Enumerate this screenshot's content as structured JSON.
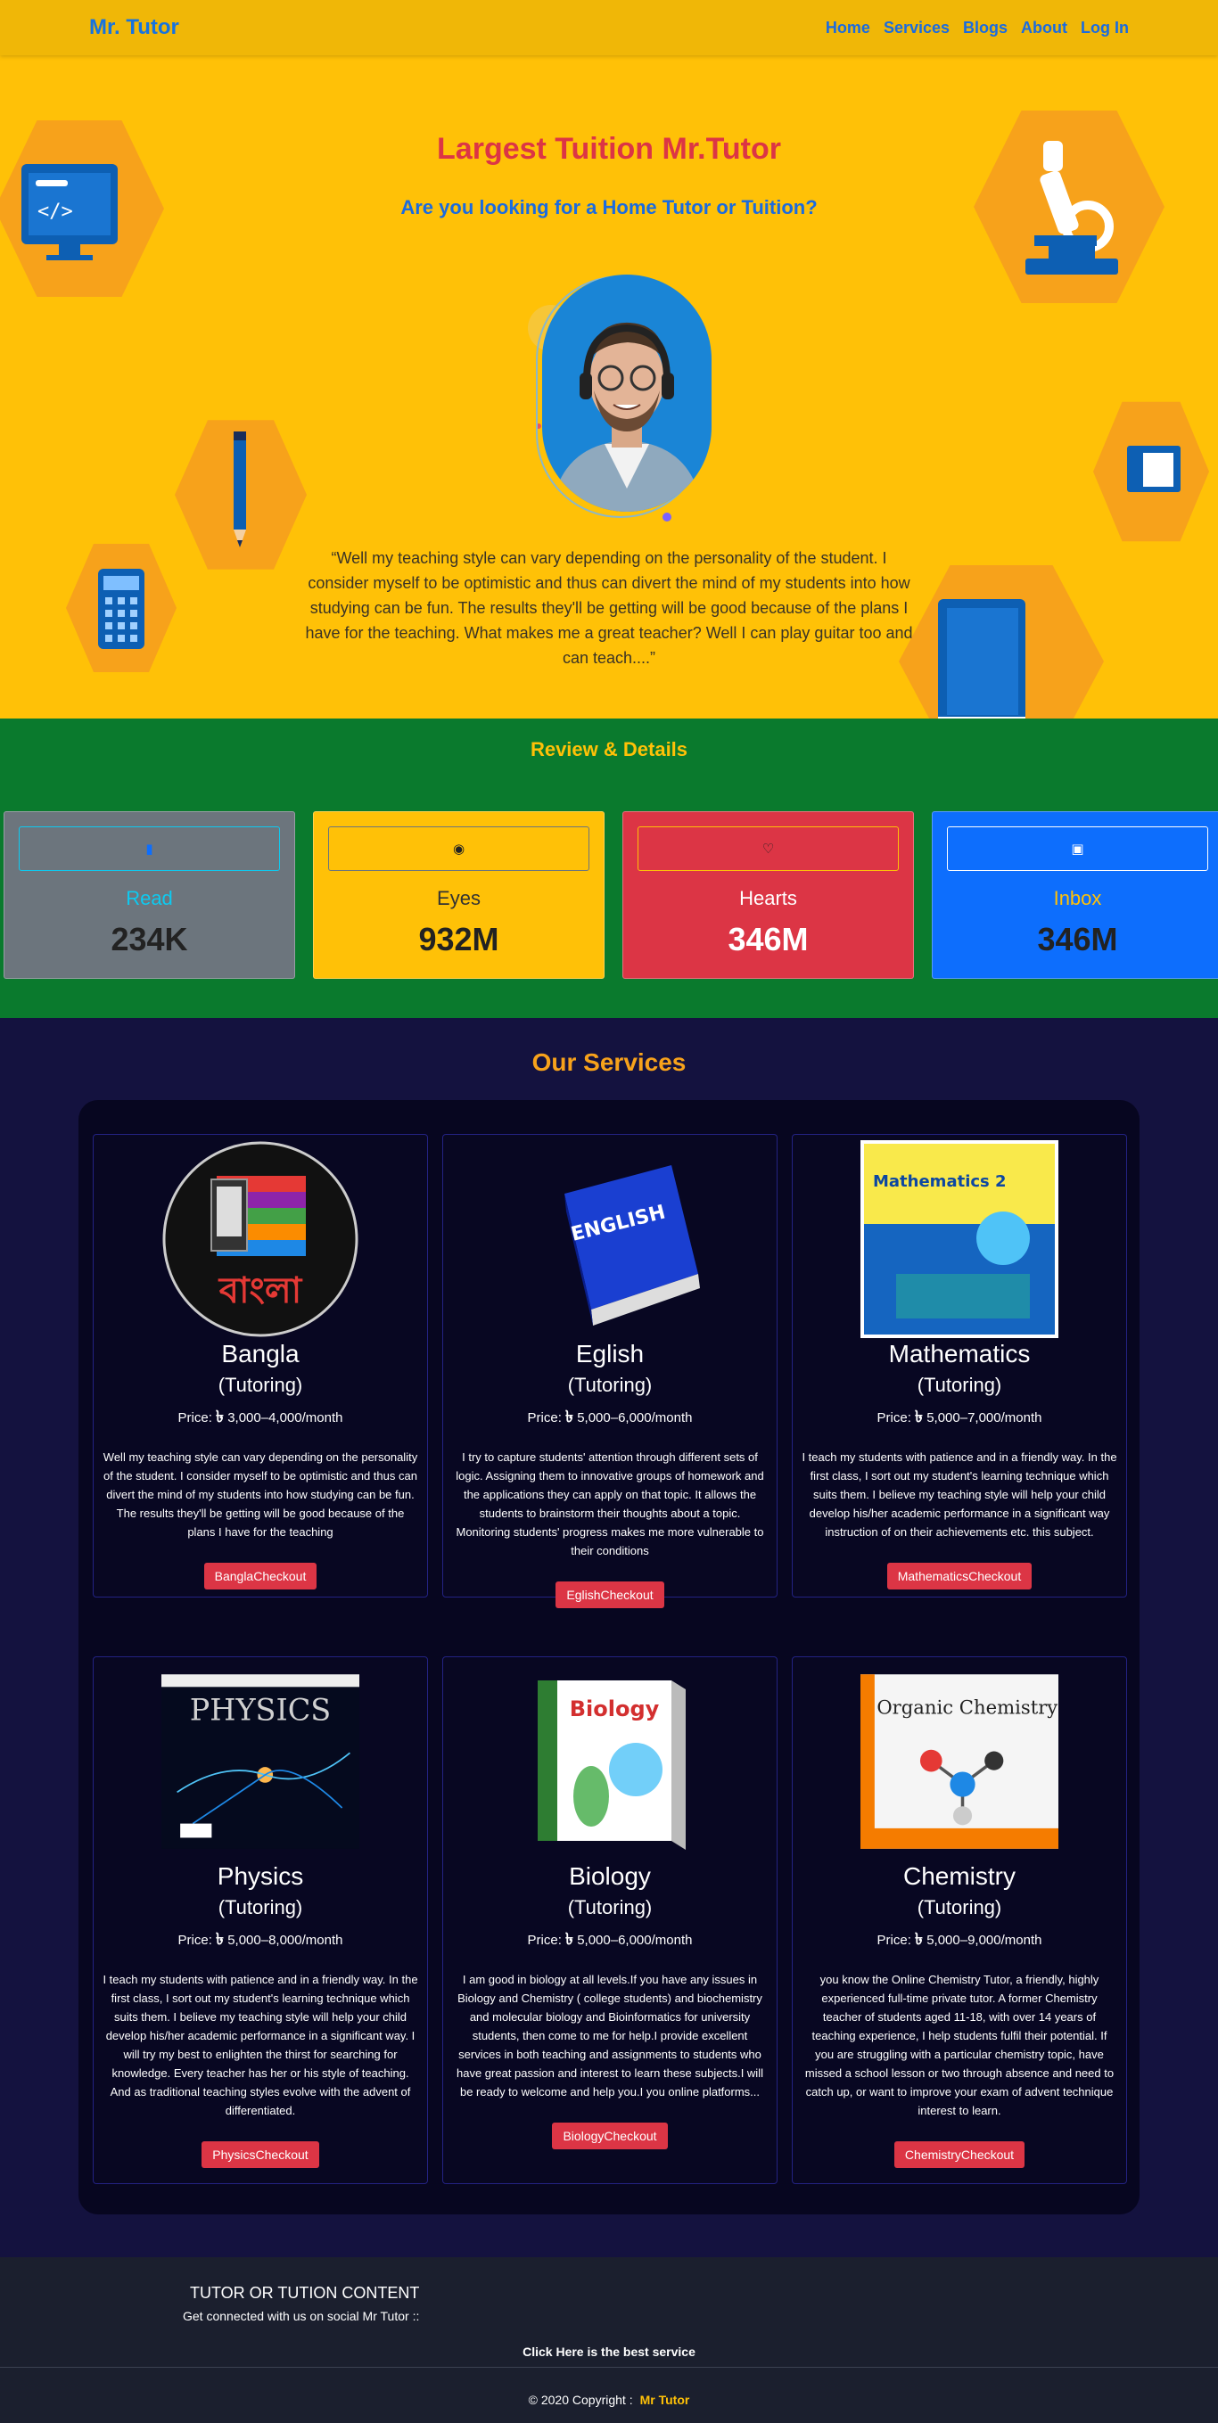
{
  "navbar": {
    "brand": "Mr. Tutor",
    "links": [
      "Home",
      "Services",
      "Blogs",
      "About",
      "Log In"
    ]
  },
  "hero": {
    "title": "Largest Tuition Mr.Tutor",
    "subtitle": "Are you looking for a Home Tutor or Tuition?",
    "quote": "“Well my teaching style can vary depending on the personality of the student. I consider myself to be optimistic and thus can divert the mind of my students into how studying can be fun. The results they'll be getting will be good because of the plans I have for the teaching. What makes me a great teacher? Well I can play guitar too and can teach....”"
  },
  "review": {
    "title": "Review & Details",
    "cards": [
      {
        "icon": "tablet-icon",
        "label": "Read",
        "value": "234K"
      },
      {
        "icon": "eye-icon",
        "label": "Eyes",
        "value": "932M"
      },
      {
        "icon": "heart-icon",
        "label": "Hearts",
        "value": "346M"
      },
      {
        "icon": "inbox-icon",
        "label": "Inbox",
        "value": "346M"
      }
    ]
  },
  "services": {
    "title": "Our Services",
    "items": [
      {
        "name": "Bangla",
        "kind": "(Tutoring)",
        "price_prefix": "Price:",
        "currency": "৳",
        "price": "3,000–4,000/month",
        "desc": "Well my teaching style can vary depending on the personality of the student. I consider myself to be optimistic and thus can divert the mind of my students into how studying can be fun. The results they'll be getting will be good because of the plans I have for the teaching",
        "button": "BanglaCheckout",
        "thumb_text": "বাংলা"
      },
      {
        "name": "Eglish",
        "kind": "(Tutoring)",
        "price_prefix": "Price:",
        "currency": "৳",
        "price": "5,000–6,000/month",
        "desc": "I try to capture students' attention through different sets of logic. Assigning them to innovative groups of homework and the applications they can apply on that topic. It allows the students to brainstorm their thoughts about a topic. Monitoring students' progress makes me more vulnerable to their conditions",
        "button": "EglishCheckout",
        "thumb_text": "ENGLISH"
      },
      {
        "name": "Mathematics",
        "kind": "(Tutoring)",
        "price_prefix": "Price:",
        "currency": "৳",
        "price": "5,000–7,000/month",
        "desc": "I teach my students with patience and in a friendly way. In the first class, I sort out my student's learning technique which suits them. I believe my teaching style will help your child develop his/her academic performance in a significant way instruction of on their achievements etc. this subject.",
        "button": "MathematicsCheckout",
        "thumb_text": "Mathematics 2"
      },
      {
        "name": "Physics",
        "kind": "(Tutoring)",
        "price_prefix": "Price:",
        "currency": "৳",
        "price": "5,000–8,000/month",
        "desc": "I teach my students with patience and in a friendly way. In the first class, I sort out my student's learning technique which suits them. I believe my teaching style will help your child develop his/her academic performance in a significant way. I will try my best to enlighten the thirst for searching for knowledge. Every teacher has her or his style of teaching. And as traditional teaching styles evolve with the advent of differentiated.",
        "button": "PhysicsCheckout",
        "thumb_text": "PHYSICS"
      },
      {
        "name": "Biology",
        "kind": "(Tutoring)",
        "price_prefix": "Price:",
        "currency": "৳",
        "price": "5,000–6,000/month",
        "desc": "I am good in biology at all levels.If you have any issues in Biology and Chemistry ( college students) and biochemistry and molecular biology and Bioinformatics for university students, then come to me for help.I provide excellent services in both teaching and assignments to students who have great passion and interest to learn these subjects.I will be ready to welcome and help you.I you online platforms...",
        "button": "BiologyCheckout",
        "thumb_text": "Biology"
      },
      {
        "name": "Chemistry",
        "kind": "(Tutoring)",
        "price_prefix": "Price:",
        "currency": "৳",
        "price": "5,000–9,000/month",
        "desc": "you know the Online Chemistry Tutor, a friendly, highly experienced full-time private tutor. A former Chemistry teacher of students aged 11-18, with over 14 years of teaching experience, I help students fulfil their potential. If you are struggling with a particular chemistry topic, have missed a school lesson or two through absence and need to catch up, or want to improve your exam of advent technique interest to learn.",
        "button": "ChemistryCheckout",
        "thumb_text": "Organic Chemistry"
      }
    ]
  },
  "footer": {
    "title": "TUTOR OR TUTION CONTENT",
    "subtitle": "Get connected with us on social Mr Tutor ::",
    "link": "Click Here is the best service",
    "copyright": "© 2020 Copyright :",
    "copyright_brand": "Mr Tutor"
  }
}
